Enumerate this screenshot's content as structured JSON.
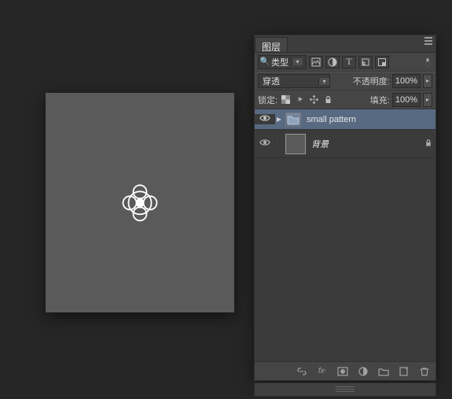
{
  "panel": {
    "tab_label": "图层",
    "filter_label": "类型",
    "blend_mode": "穿透",
    "opacity_label": "不透明度:",
    "opacity_value": "100%",
    "lock_label": "锁定:",
    "fill_label": "填充:",
    "fill_value": "100%"
  },
  "layers": [
    {
      "name": "small pattern",
      "type": "group",
      "selected": true,
      "locked": false
    },
    {
      "name": "背景",
      "type": "layer",
      "selected": false,
      "locked": true,
      "thumb_bg": "#5a5a5a"
    }
  ],
  "icons": {
    "filter_image": "image",
    "filter_adjust": "circle-half",
    "filter_text": "T",
    "filter_shape": "rect",
    "filter_smart": "smart",
    "link": "link",
    "fx": "fx",
    "mask": "mask",
    "adjustment": "circle-half",
    "new_group": "folder",
    "new_layer": "page",
    "delete": "trash"
  }
}
